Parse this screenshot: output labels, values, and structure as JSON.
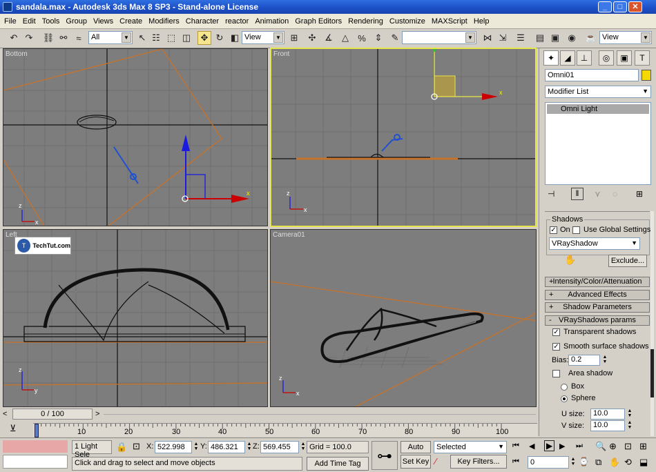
{
  "window": {
    "title": "sandala.max - Autodesk 3ds Max 8 SP3  - Stand-alone License"
  },
  "menu": [
    "File",
    "Edit",
    "Tools",
    "Group",
    "Views",
    "Create",
    "Modifiers",
    "Character",
    "reactor",
    "Animation",
    "Graph Editors",
    "Rendering",
    "Customize",
    "MAXScript",
    "Help"
  ],
  "toolbar": {
    "selection_filter": "All",
    "ref_coord": "View",
    "named_selection": "",
    "view_dropdown": "View"
  },
  "viewports": {
    "top_left": "Bottom",
    "top_right": "Front",
    "bottom_left": "Left",
    "bottom_right": "Camera01",
    "watermark": "TechTut.com",
    "axis_x": "x",
    "axis_y": "y",
    "axis_z": "z"
  },
  "command_panel": {
    "object_name": "Omni01",
    "object_color": "#f5d800",
    "modifier_list": "Modifier List",
    "stack_item": "Omni Light",
    "shadows_group": "Shadows",
    "shadows_on_label": "On",
    "use_global_label": "Use Global Settings",
    "shadow_type": "VRayShadow",
    "exclude_button": "Exclude...",
    "rollouts": [
      {
        "sign": "+",
        "label": "Intensity/Color/Attenuation"
      },
      {
        "sign": "+",
        "label": "Advanced Effects"
      },
      {
        "sign": "+",
        "label": "Shadow Parameters"
      },
      {
        "sign": "-",
        "label": "VRayShadows params"
      }
    ],
    "transparent_shadows": "Transparent shadows",
    "smooth_surface_shadows": "Smooth surface shadows",
    "bias_label": "Bias:",
    "bias_value": "0.2",
    "area_shadow": "Area shadow",
    "box_label": "Box",
    "sphere_label": "Sphere",
    "u_size_label": "U size:",
    "u_size_value": "10.0",
    "v_size_label": "V size:",
    "v_size_value": "10.0"
  },
  "timeline": {
    "frame_display": "0 / 100",
    "ticks": [
      "0",
      "10",
      "20",
      "30",
      "40",
      "50",
      "60",
      "70",
      "80",
      "90",
      "100"
    ]
  },
  "status": {
    "selection_count": "1 Light Sele",
    "x_label": "X:",
    "x_value": "522.998",
    "y_label": "Y:",
    "y_value": "486.321",
    "z_label": "Z:",
    "z_value": "569.455",
    "grid": "Grid = 100.0",
    "prompt": "Click and drag to select and move objects",
    "add_time_tag": "Add Time Tag",
    "auto_key": "Auto Key",
    "set_key": "Set Key",
    "key_mode": "Selected",
    "key_filters": "Key Filters...",
    "current_frame": "0"
  }
}
